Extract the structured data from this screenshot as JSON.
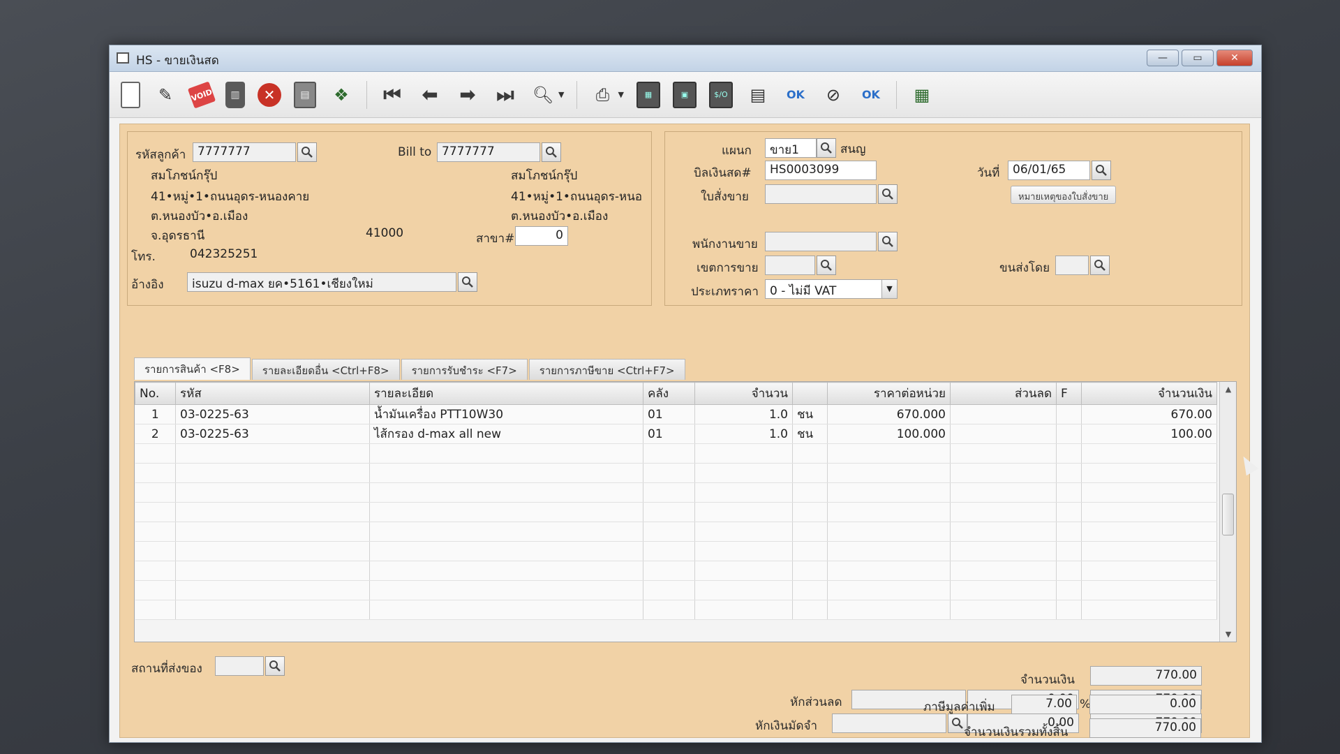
{
  "window": {
    "title": "HS - ขายเงินสด",
    "minimize": "—",
    "maximize": "▭",
    "close": "✕"
  },
  "toolbar": {
    "icons": [
      "new-document-icon",
      "edit-icon",
      "void-icon",
      "delete-icon",
      "cancel-icon",
      "save-icon",
      "copy-icon",
      "first-record-icon",
      "previous-record-icon",
      "next-record-icon",
      "last-record-icon",
      "search-document-icon",
      "print-icon",
      "report-icon",
      "calculator-icon",
      "cash-icon",
      "receipt-icon",
      "approve-icon",
      "unapprove-icon",
      "confirm-icon",
      "export-icon"
    ],
    "void_label": "VOID",
    "approve_label": "OK",
    "confirm_label": "OK",
    "cash_label": "$/O"
  },
  "customer": {
    "code_label": "รหัสลูกค้า",
    "code": "7777777",
    "billto_label": "Bill to",
    "billto": "7777777",
    "name": "สมโภชน์กรุ๊ป",
    "address1": "41•หมู่•1•ถนนอุดร-หนองคาย",
    "address2": "ต.หนองบัว•อ.เมือง",
    "province": "จ.อุดรธานี",
    "postcode": "41000",
    "billto_name": "สมโภชน์กรุ๊ป",
    "billto_address1": "41•หมู่•1•ถนนอุดร-หนอ",
    "billto_address2": "ต.หนองบัว•อ.เมือง",
    "branch_label": "สาขา#",
    "branch": "0",
    "phone_label": "โทร.",
    "phone": "042325251",
    "ref_label": "อ้างอิง",
    "ref": "isuzu d-max ยค•5161•เชียงใหม่"
  },
  "doc": {
    "dept_label": "แผนก",
    "dept": "ขาย1",
    "dept_name": "สนญ",
    "bill_label": "บิลเงินสด#",
    "bill": "HS0003099",
    "date_label": "วันที่",
    "date": "06/01/65",
    "order_label": "ใบสั่งขาย",
    "order": "",
    "order_note_btn": "หมายเหตุของใบสั่งขาย",
    "salesman_label": "พนักงานขาย",
    "salesman": "",
    "area_label": "เขตการขาย",
    "area": "",
    "ship_label": "ขนส่งโดย",
    "ship": "",
    "pricetype_label": "ประเภทราคา",
    "pricetype": "0 - ไม่มี VAT"
  },
  "tabs": [
    "รายการสินค้า <F8>",
    "รายละเอียดอื่น <Ctrl+F8>",
    "รายการรับชำระ <F7>",
    "รายการภาษีขาย <Ctrl+F7>"
  ],
  "grid": {
    "headers": [
      "No.",
      "รหัส",
      "รายละเอียด",
      "คลัง",
      "จำนวน",
      "",
      "ราคาต่อหน่วย",
      "ส่วนลด",
      "F",
      "จำนวนเงิน"
    ],
    "rows": [
      [
        "1",
        "03-0225-63",
        "น้ำมันเครื่อง PTT10W30",
        "01",
        "1.0",
        "ชน",
        "670.000",
        "",
        "",
        "670.00"
      ],
      [
        "2",
        "03-0225-63",
        "ไส้กรอง d-max all new",
        "01",
        "1.0",
        "ชน",
        "100.000",
        "",
        "",
        "100.00"
      ]
    ]
  },
  "footer": {
    "delivery_label": "สถานที่ส่งของ",
    "delivery": "",
    "amount_label": "จำนวนเงิน",
    "amount": "770.00",
    "discount_label": "หักส่วนลด",
    "discount_input": "",
    "discount_value": "0.00",
    "after_discount": "770.00",
    "deposit_label": "หักเงินมัดจำ",
    "deposit_input": "",
    "deposit_value": "0.00",
    "after_deposit": "770.00",
    "vat_label": "ภาษีมูลค่าเพิ่ม",
    "vat_rate": "7.00",
    "vat_percent": "%",
    "vat_amount": "0.00",
    "total_label": "จำนวนเงินรวมทั้งสิ้น",
    "total": "770.00"
  }
}
